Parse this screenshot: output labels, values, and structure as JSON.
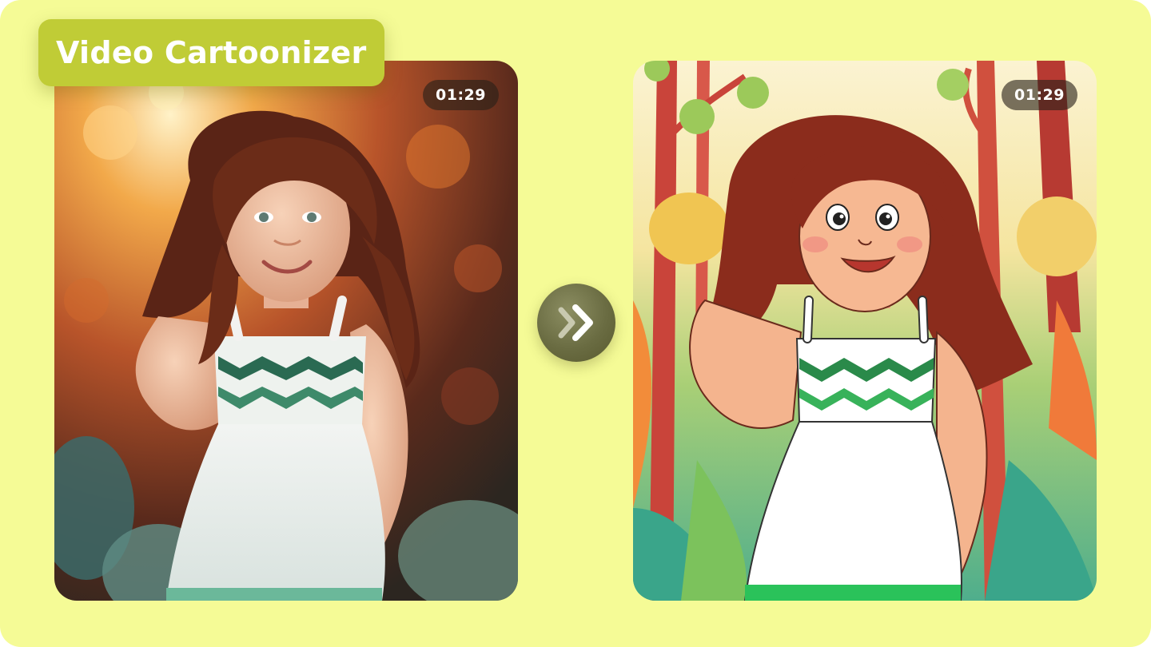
{
  "title": "Video Cartoonizer",
  "original_video": {
    "duration": "01:29"
  },
  "cartoon_video": {
    "duration": "01:29"
  },
  "convert_button": {
    "icon": "double-chevron-right-icon"
  },
  "colors": {
    "background": "#f5fb96",
    "title_tag": "#c0cc36",
    "convert_button": "#6a6c42"
  }
}
